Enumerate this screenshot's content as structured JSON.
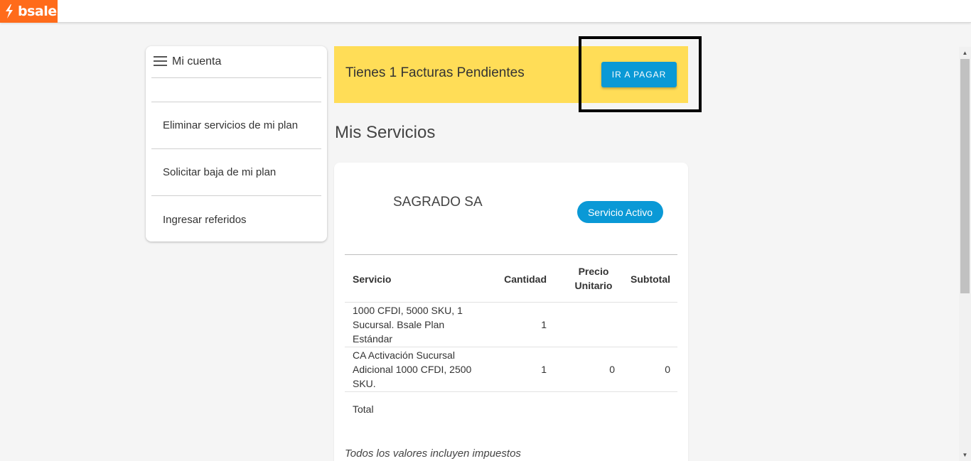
{
  "app": {
    "logo_text": "bsale",
    "brand_color": "#ff6b1a",
    "accent_color": "#0a99d6",
    "banner_color": "#ffdd57"
  },
  "sidebar": {
    "title": "Mi cuenta",
    "items": [
      {
        "label": "Eliminar servicios de mi plan"
      },
      {
        "label": "Solicitar baja de mi plan"
      },
      {
        "label": "Ingresar referidos"
      }
    ]
  },
  "banner": {
    "text": "Tienes 1 Facturas Pendientes",
    "button_label": "IR A PAGAR"
  },
  "main": {
    "heading": "Mis Servicios",
    "card": {
      "company": "SAGRADO SA",
      "status": "Servicio Activo",
      "table": {
        "headers": {
          "service": "Servicio",
          "quantity": "Cantidad",
          "unit_price": "Precio Unitario",
          "subtotal": "Subtotal"
        },
        "rows": [
          {
            "service": "1000 CFDI, 5000 SKU, 1 Sucursal. Bsale Plan Estándar",
            "quantity": "1",
            "unit_price": "",
            "subtotal": ""
          },
          {
            "service": "CA Activación Sucursal Adicional 1000 CFDI, 2500 SKU.",
            "quantity": "1",
            "unit_price": "0",
            "subtotal": "0"
          }
        ],
        "total_label": "Total"
      },
      "note": "Todos los valores incluyen impuestos"
    }
  }
}
